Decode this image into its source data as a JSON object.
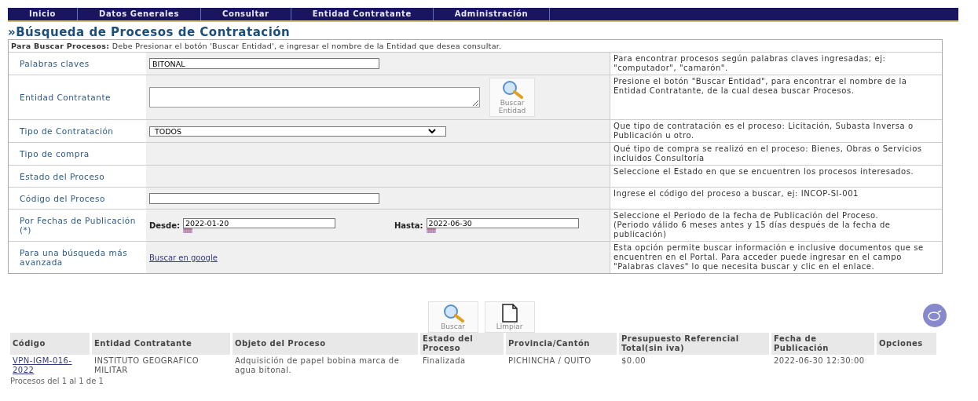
{
  "nav": [
    {
      "label": "Inicio"
    },
    {
      "label": "Datos Generales"
    },
    {
      "label": "Consultar"
    },
    {
      "label": "Entidad Contratante"
    },
    {
      "label": "Administración"
    }
  ],
  "title": "»Búsqueda de Procesos de Contratación",
  "instructions": {
    "label": "Para Buscar Procesos:",
    "text": "Debe Presionar el botón 'Buscar Entidad', e ingresar el nombre de la Entidad que desea consultar."
  },
  "form_rows": [
    {
      "kind": "text",
      "label": "Palabras claves",
      "value": "BITONAL",
      "help": "Para encontrar procesos según palabras claves ingresadas; ej: \"computador\", \"camarón\"."
    },
    {
      "kind": "textarea",
      "label": "Entidad Contratante",
      "value": "",
      "button": "Buscar Entidad",
      "help": "Presione el botón \"Buscar Entidad\", para encontrar el nombre de la Entidad Contratante, de la cual desea buscar Procesos."
    },
    {
      "kind": "select",
      "label": "Tipo de Contratación",
      "value": "TODOS",
      "help": "Que tipo de contratación es el proceso: Licitación, Subasta Inversa o Publicación u otro."
    },
    {
      "kind": "empty",
      "label": "Tipo de compra",
      "help": "Qué tipo de compra se realizó en el proceso: Bienes, Obras o Servicios incluidos Consultoría"
    },
    {
      "kind": "empty",
      "label": "Estado del Proceso",
      "help": "Seleccione el Estado en que se encuentren los procesos interesados."
    },
    {
      "kind": "text",
      "label": "Código del Proceso",
      "value": "",
      "help": "Ingrese el código del proceso a buscar, ej: INCOP-SI-001"
    },
    {
      "kind": "dates",
      "label": "Por Fechas de Publicación (*)",
      "from_label": "Desde:",
      "from_value": "2022-01-20",
      "to_label": "Hasta:",
      "to_value": "2022-06-30",
      "help": "Seleccione el Periodo de la fecha de Publicación del Proceso.\n(Periodo válido 6 meses antes y 15 días después de la fecha de publicación)"
    },
    {
      "kind": "link",
      "label": "Para una búsqueda más avanzada",
      "link": "Buscar en google",
      "help": "Esta opción permite buscar información e inclusive documentos que se encuentren en el Portal. Para acceder puede ingresar en el campo \"Palabras claves\" lo que necesita buscar y clic en el enlace."
    }
  ],
  "actions": [
    {
      "kind": "search",
      "label": "Buscar"
    },
    {
      "kind": "clear",
      "label": "Limpiar"
    }
  ],
  "results": {
    "columns": [
      "Código",
      "Entidad Contratante",
      "Objeto del Proceso",
      "Estado del Proceso",
      "Provincia/Cantón",
      "Presupuesto Referencial Total(sin iva)",
      "Fecha de Publicación",
      "Opciones"
    ],
    "rows": [
      {
        "cells": [
          "VPN-IGM-016-2022",
          "INSTITUTO GEOGRAFICO MILITAR",
          "Adquisición de papel bobina marca de agua bitonal.",
          "Finalizada",
          "PICHINCHA / QUITO",
          "$0.00",
          "2022-06-30 12:30:00",
          ""
        ]
      }
    ],
    "footer": "Procesos del 1 al 1 de 1"
  }
}
